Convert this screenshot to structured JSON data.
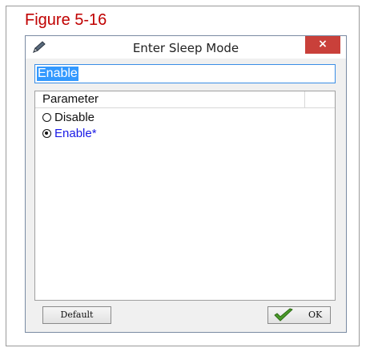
{
  "figure": {
    "label": "Figure 5-16"
  },
  "dialog": {
    "title": "Enter Sleep Mode",
    "close_symbol": "×",
    "value_field": {
      "value": "Enable"
    },
    "list": {
      "header": "Parameter",
      "options": [
        {
          "label": "Disable",
          "selected": false
        },
        {
          "label": "Enable*",
          "selected": true
        }
      ]
    },
    "buttons": {
      "default_label": "Default",
      "ok_label": "OK"
    }
  },
  "icons": {
    "app_icon": "pencil-icon",
    "ok_icon": "checkmark-icon"
  },
  "colors": {
    "figure_label": "#c00000",
    "close_button": "#c9403a",
    "selection": "#3399ff",
    "default_option_text": "#1a1ae6",
    "checkmark": "#4a9a2a"
  }
}
